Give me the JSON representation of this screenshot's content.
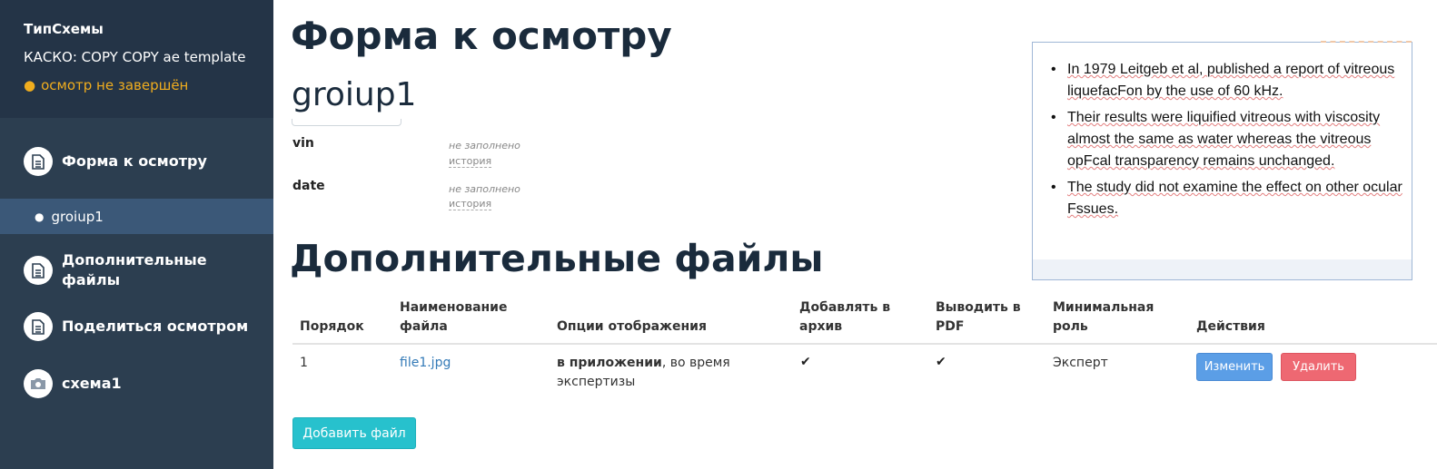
{
  "sidebar": {
    "schema_type": "ТипСхемы",
    "template": "КАСКО: COPY COPY ae template",
    "status": "осмотр не завершён",
    "items": [
      {
        "label": "Форма к осмотру",
        "icon": "document-icon"
      },
      {
        "label": "Дополнительные файлы",
        "icon": "document-icon"
      },
      {
        "label": "Поделиться осмотром",
        "icon": "document-icon"
      },
      {
        "label": "схема1",
        "icon": "camera-icon"
      }
    ],
    "sub_item": "groiup1",
    "colors": {
      "status": "#f0ad1e",
      "background": "#2c3e50",
      "active": "#3b5878"
    }
  },
  "main": {
    "title": "Форма к осмотру",
    "group_title": "groiup1",
    "fields": [
      {
        "label": "vin",
        "value": "не заполнено",
        "history": "история"
      },
      {
        "label": "date",
        "value": "не заполнено",
        "history": "история"
      }
    ],
    "files_title": "Дополнительные файлы",
    "table": {
      "headers": [
        "Порядок",
        "Наименование файла",
        "Опции отображения",
        "Добавлять в архив",
        "Выводить в PDF",
        "Минимальная роль",
        "Действия"
      ],
      "rows": [
        {
          "order": "1",
          "file": "file1.jpg",
          "option_bold": "в приложении",
          "option_rest": ", во время экспертизы",
          "role": "Эксперт"
        }
      ],
      "edit_label": "Изменить",
      "delete_label": "Удалить"
    },
    "add_file_label": "Добавить файл"
  },
  "image_panel": {
    "bullets": [
      "In 1979 Leitgeb et al, published a report of vitreous liquefacFon by the use of 60 kHz.",
      "Their results were liquified vitreous with viscosity almost the same as water whereas the vitreous opFcal transparency remains unchanged.",
      "The study did not examine the effect on other ocular Fssues."
    ]
  }
}
